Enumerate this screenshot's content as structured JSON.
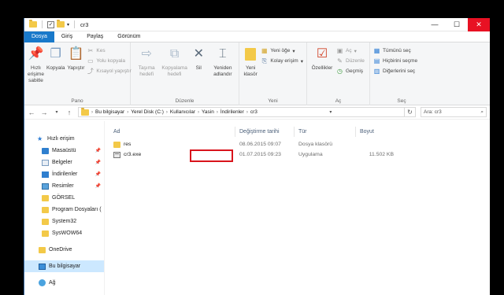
{
  "window": {
    "title": "cr3",
    "buttons": {
      "minimize": "—",
      "maximize": "☐",
      "close": "✕"
    }
  },
  "tabs": [
    "Dosya",
    "Giriş",
    "Paylaş",
    "Görünüm"
  ],
  "ribbon": {
    "pano": {
      "label": "Pano",
      "pin": "Hızlı erişime sabitle",
      "copy": "Kopyala",
      "paste": "Yapıştır",
      "cut": "Kes",
      "copy_path": "Yolu kopyala",
      "paste_shortcut": "Kısayol yapıştır"
    },
    "duzenle": {
      "label": "Düzenle",
      "move_to": "Taşıma hedefi",
      "copy_to": "Kopyalama hedefi",
      "delete": "Sil",
      "rename": "Yeniden adlandır"
    },
    "yeni": {
      "label": "Yeni",
      "new_folder": "Yeni klasör",
      "new_item": "Yeni öğe",
      "easy_access": "Kolay erişim"
    },
    "ac": {
      "label": "Aç",
      "properties": "Özellikler",
      "open": "Aç",
      "edit": "Düzenle",
      "history": "Geçmiş"
    },
    "sec": {
      "label": "Seç",
      "select_all": "Tümünü seç",
      "select_none": "Hiçbirini seçme",
      "invert": "Diğerlerini seç"
    }
  },
  "address": {
    "crumbs": [
      "Bu bilgisayar",
      "Yerel Disk (C:)",
      "Kullanıcılar",
      "Yasin",
      "İndirilenler",
      "cr3"
    ],
    "search_placeholder": "Ara: cr3"
  },
  "nav": {
    "quick_access": "Hızlı erişim",
    "pinned": [
      "Masaüstü",
      "Belgeler",
      "İndirilenler",
      "Resimler"
    ],
    "folders": [
      "GÖRSEL",
      "Program Dosyaları (",
      "System32",
      "SysWOW64"
    ],
    "onedrive": "OneDrive",
    "this_pc": "Bu bilgisayar",
    "network": "Ağ"
  },
  "columns": {
    "name": "Ad",
    "date": "Değiştirme tarihi",
    "type": "Tür",
    "size": "Boyut"
  },
  "files": [
    {
      "name": "res",
      "date": "08.06.2015 09:07",
      "type": "Dosya klasörü",
      "size": ""
    },
    {
      "name": "cr3.exe",
      "date": "01.07.2015 09:23",
      "type": "Uygulama",
      "size": "11.502 KB"
    }
  ],
  "colors": {
    "accent": "#1979ca",
    "highlight_box": "#d9141c",
    "selection": "#cce8ff"
  }
}
